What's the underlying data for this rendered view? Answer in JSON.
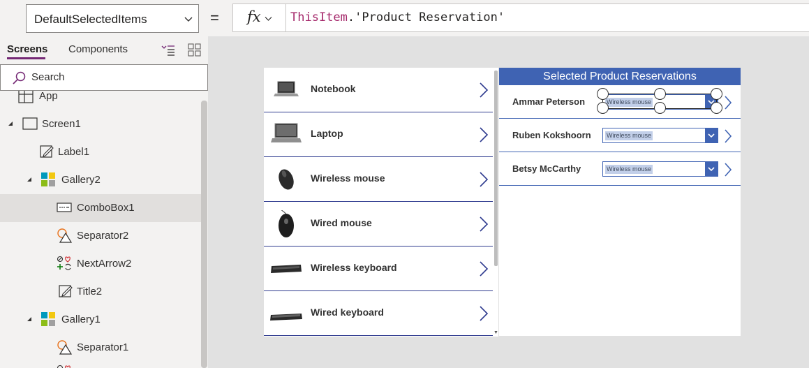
{
  "formula_bar": {
    "property": "DefaultSelectedItems",
    "equals": "=",
    "fx_label": "fx",
    "formula_keyword": "ThisItem",
    "formula_rest": ".'Product Reservation'"
  },
  "left_panel": {
    "tabs": [
      {
        "label": "Screens",
        "active": true
      },
      {
        "label": "Components",
        "active": false
      }
    ],
    "search": {
      "placeholder": "Search"
    },
    "tree": [
      {
        "label": "App",
        "icon": "app-icon"
      },
      {
        "label": "Screen1",
        "icon": "screen-icon",
        "expanded": true
      },
      {
        "label": "Label1",
        "icon": "label-icon"
      },
      {
        "label": "Gallery2",
        "icon": "gallery-icon",
        "expanded": true
      },
      {
        "label": "ComboBox1",
        "icon": "combobox-icon",
        "selected": true
      },
      {
        "label": "Separator2",
        "icon": "shapes-icon"
      },
      {
        "label": "NextArrow2",
        "icon": "icons-control-icon"
      },
      {
        "label": "Title2",
        "icon": "label-icon"
      },
      {
        "label": "Gallery1",
        "icon": "gallery-icon",
        "expanded": true
      },
      {
        "label": "Separator1",
        "icon": "shapes-icon"
      }
    ]
  },
  "canvas": {
    "products": [
      {
        "name": "Notebook",
        "image": "notebook-image"
      },
      {
        "name": "Laptop",
        "image": "laptop-image"
      },
      {
        "name": "Wireless mouse",
        "image": "wireless-mouse-image"
      },
      {
        "name": "Wired mouse",
        "image": "wired-mouse-image"
      },
      {
        "name": "Wireless keyboard",
        "image": "wireless-keyboard-image"
      },
      {
        "name": "Wired keyboard",
        "image": "wired-keyboard-image"
      }
    ],
    "reservations_title": "Selected Product Reservations",
    "reservations": [
      {
        "name": "Ammar Peterson",
        "item": "Wireless mouse",
        "selected": true
      },
      {
        "name": "Ruben Kokshoorn",
        "item": "Wireless mouse"
      },
      {
        "name": "Betsy McCarthy",
        "item": "Wireless mouse"
      }
    ]
  },
  "colors": {
    "accent_blue": "#3f63b3",
    "separator_navy": "#2f3b8f",
    "formula_keyword": "#a5286b",
    "tab_underline": "#742774"
  }
}
